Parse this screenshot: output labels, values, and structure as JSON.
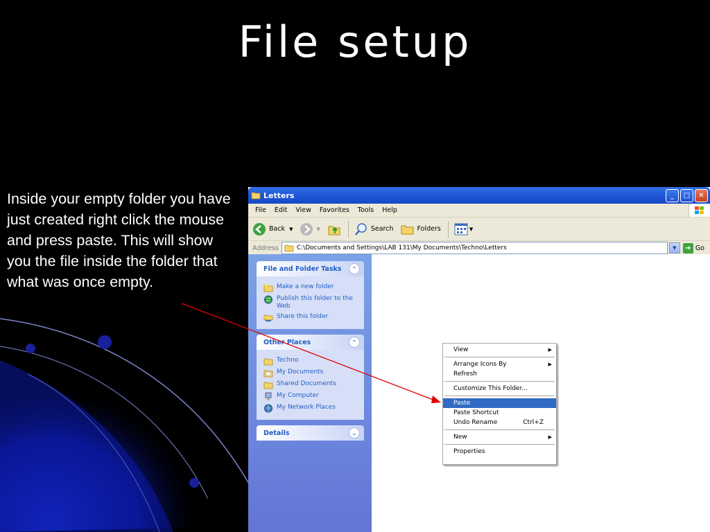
{
  "slide": {
    "title": "File setup",
    "body": "Inside your empty folder you have just created right click the mouse and press paste. This will show you the file inside the folder that what was once empty."
  },
  "window": {
    "title": "Letters",
    "menu": [
      "File",
      "Edit",
      "View",
      "Favorites",
      "Tools",
      "Help"
    ],
    "toolbar": {
      "back": "Back",
      "search": "Search",
      "folders": "Folders"
    },
    "address": {
      "label": "Address",
      "value": "C:\\Documents and Settings\\LAB 131\\My Documents\\Techno\\Letters",
      "go": "Go"
    }
  },
  "tasks_panel": {
    "title": "File and Folder Tasks",
    "items": [
      "Make a new folder",
      "Publish this folder to the Web",
      "Share this folder"
    ]
  },
  "places_panel": {
    "title": "Other Places",
    "items": [
      "Techno",
      "My Documents",
      "Shared Documents",
      "My Computer",
      "My Network Places"
    ]
  },
  "details_panel": {
    "title": "Details"
  },
  "context_menu": {
    "view": "View",
    "arrange": "Arrange Icons By",
    "refresh": "Refresh",
    "customize": "Customize This Folder...",
    "paste": "Paste",
    "paste_shortcut": "Paste Shortcut",
    "undo": "Undo Rename",
    "undo_shortcut": "Ctrl+Z",
    "new": "New",
    "properties": "Properties"
  },
  "colors": {
    "slide_bg": "#000000",
    "accent": "#215dc6",
    "arrow": "#e00000",
    "highlight": "#316ac5"
  }
}
